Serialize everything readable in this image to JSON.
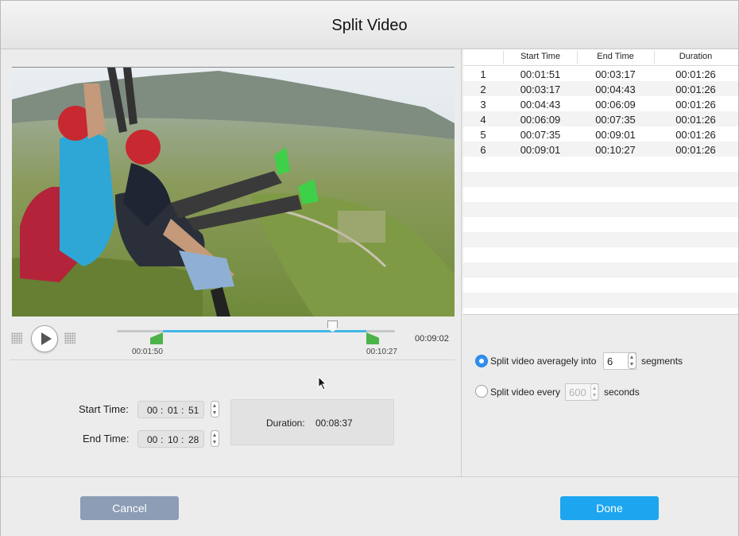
{
  "window": {
    "title": "Split Video"
  },
  "player": {
    "segment_start": "00:01:50",
    "segment_end": "00:10:27",
    "current_time": "00:09:02"
  },
  "trim": {
    "start_label": "Start Time:",
    "start": {
      "h": "00",
      "m": "01",
      "s": "51"
    },
    "end_label": "End Time:",
    "end": {
      "h": "00",
      "m": "10",
      "s": "28"
    },
    "duration_label": "Duration:",
    "duration_value": "00:08:37"
  },
  "segments_table": {
    "headers": [
      "",
      "Start Time",
      "End Time",
      "Duration"
    ],
    "rows": [
      [
        "1",
        "00:01:51",
        "00:03:17",
        "00:01:26"
      ],
      [
        "2",
        "00:03:17",
        "00:04:43",
        "00:01:26"
      ],
      [
        "3",
        "00:04:43",
        "00:06:09",
        "00:01:26"
      ],
      [
        "4",
        "00:06:09",
        "00:07:35",
        "00:01:26"
      ],
      [
        "5",
        "00:07:35",
        "00:09:01",
        "00:01:26"
      ],
      [
        "6",
        "00:09:01",
        "00:10:27",
        "00:01:26"
      ]
    ]
  },
  "split_options": {
    "average_label": "Split video averagely into",
    "average_value": "6",
    "average_unit": "segments",
    "every_label": "Split video every",
    "every_value": "600",
    "every_unit": "seconds",
    "selected": "average"
  },
  "buttons": {
    "cancel": "Cancel",
    "done": "Done"
  },
  "colors": {
    "accent": "#1da6ef",
    "cancel": "#8c9db5",
    "range_handles": "#4cb34a",
    "range_fill": "#42b6e6"
  }
}
